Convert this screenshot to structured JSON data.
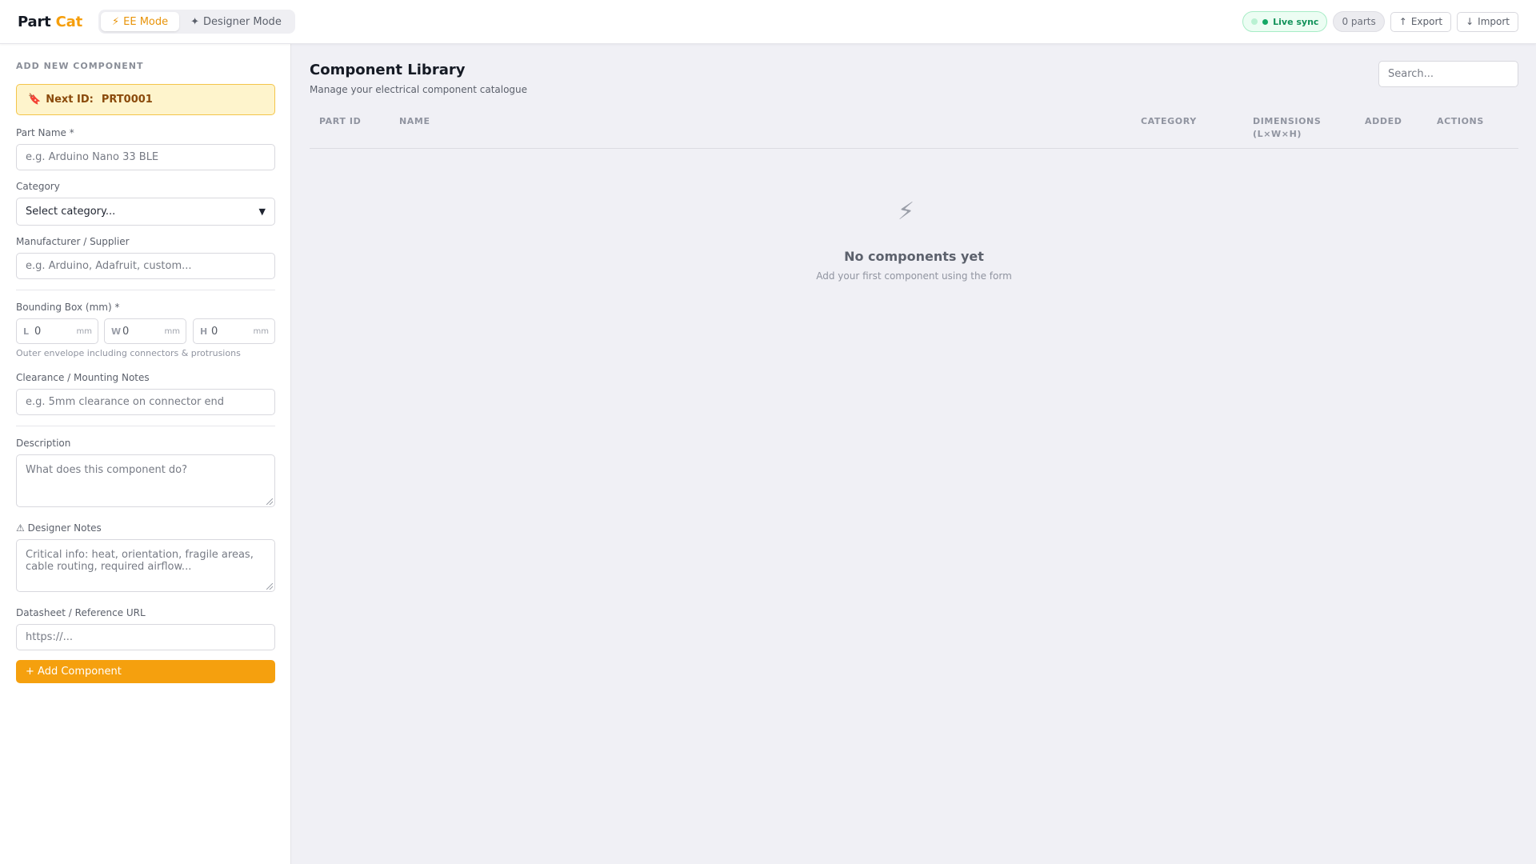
{
  "header": {
    "brand_part": "Part",
    "brand_cat": "Cat",
    "modes": [
      {
        "label": "EE Mode",
        "icon": "⚡",
        "active": true
      },
      {
        "label": "Designer Mode",
        "icon": "✦",
        "active": false
      }
    ],
    "live_sync": "Live sync",
    "parts_count": "0 parts",
    "export_label": "Export",
    "export_icon": "↑",
    "import_label": "Import",
    "import_icon": "↓"
  },
  "sidebar": {
    "section_title": "ADD NEW COMPONENT",
    "next_id_label": "Next ID:",
    "next_id_value": "PRT0001",
    "part_name_label": "Part Name *",
    "part_name_placeholder": "e.g. Arduino Nano 33 BLE",
    "category_label": "Category",
    "category_selected": "Select category...",
    "manufacturer_label": "Manufacturer / Supplier",
    "manufacturer_placeholder": "e.g. Arduino, Adafruit, custom...",
    "bbox_label": "Bounding Box (mm) *",
    "dims": [
      {
        "axis": "L",
        "value": "0",
        "unit": "mm"
      },
      {
        "axis": "W",
        "value": "0",
        "unit": "mm"
      },
      {
        "axis": "H",
        "value": "0",
        "unit": "mm"
      }
    ],
    "bbox_hint": "Outer envelope including connectors & protrusions",
    "clearance_label": "Clearance / Mounting Notes",
    "clearance_placeholder": "e.g. 5mm clearance on connector end",
    "description_label": "Description",
    "description_placeholder": "What does this component do?",
    "designer_notes_label": "⚠ Designer Notes",
    "designer_notes_placeholder_1": "Critical info: heat, orientation, fragile areas,",
    "designer_notes_placeholder_2": "cable routing, required airflow...",
    "datasheet_label": "Datasheet / Reference URL",
    "datasheet_placeholder": "https://...",
    "add_button": "+ Add Component"
  },
  "main": {
    "title": "Component Library",
    "subtitle": "Manage your electrical component catalogue",
    "search_placeholder": "Search...",
    "columns": {
      "part_id": "PART ID",
      "name": "NAME",
      "category": "CATEGORY",
      "dimensions_1": "DIMENSIONS",
      "dimensions_2": "(L×W×H)",
      "added": "ADDED",
      "actions": "ACTIONS"
    },
    "empty_icon": "⚡",
    "empty_title": "No components yet",
    "empty_subtitle": "Add your first component using the form"
  },
  "colors": {
    "accent": "#f5a00e",
    "live_green": "#13a865",
    "next_id_bg": "#fef4cc"
  }
}
